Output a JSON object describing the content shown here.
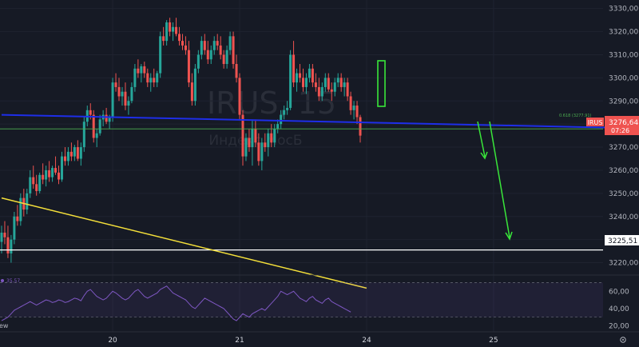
{
  "watermark": {
    "symbol": "IRUS, 15",
    "name": "Индекс МосБ"
  },
  "symbol_badge": "IRUS",
  "last_price_label": "3276,64",
  "countdown_label": "07:26",
  "support_label": "3225,51",
  "fib_label": "0.618 (3277.91)",
  "rsi_label": "35,57",
  "side_label": "ew",
  "footer_icon": "settings-icon",
  "colors": {
    "background": "#161a25",
    "up": "#26a69a",
    "down": "#ef5350",
    "blue_line": "#1e2ee8",
    "yellow_line": "#f5e03a",
    "arrow": "#39e63a",
    "rsi": "#7e57c2",
    "support": "#ffffff",
    "fib": "#4caf50"
  },
  "chart_data": {
    "type": "candlestick",
    "price_axis": {
      "ylim": [
        3215.0,
        3333.0
      ],
      "ticks": [
        "3330,00",
        "3320,00",
        "3310,00",
        "3300,00",
        "3290,00",
        "3280,00",
        "3270,00",
        "3260,00",
        "3250,00",
        "3240,00",
        "3230,00",
        "3220,00"
      ]
    },
    "x_ticks": [
      "20",
      "21",
      "24",
      "25"
    ],
    "x_tick_bars": [
      35,
      75,
      115,
      155
    ],
    "bars_visible": 190,
    "candles": [
      [
        3229,
        3236,
        3224,
        3233
      ],
      [
        3233,
        3238,
        3228,
        3231
      ],
      [
        3231,
        3236,
        3222,
        3224
      ],
      [
        3224,
        3232,
        3220,
        3230
      ],
      [
        3230,
        3242,
        3228,
        3240
      ],
      [
        3240,
        3245,
        3236,
        3238
      ],
      [
        3238,
        3250,
        3236,
        3248
      ],
      [
        3248,
        3252,
        3240,
        3243
      ],
      [
        3243,
        3252,
        3241,
        3250
      ],
      [
        3250,
        3260,
        3248,
        3257
      ],
      [
        3257,
        3262,
        3252,
        3254
      ],
      [
        3254,
        3258,
        3249,
        3251
      ],
      [
        3251,
        3259,
        3250,
        3258
      ],
      [
        3258,
        3263,
        3254,
        3256
      ],
      [
        3256,
        3262,
        3253,
        3260
      ],
      [
        3260,
        3264,
        3255,
        3257
      ],
      [
        3257,
        3262,
        3255,
        3261
      ],
      [
        3261,
        3266,
        3258,
        3259
      ],
      [
        3259,
        3262,
        3254,
        3256
      ],
      [
        3256,
        3268,
        3255,
        3266
      ],
      [
        3266,
        3270,
        3262,
        3264
      ],
      [
        3264,
        3270,
        3262,
        3268
      ],
      [
        3268,
        3272,
        3264,
        3266
      ],
      [
        3266,
        3271,
        3264,
        3270
      ],
      [
        3270,
        3273,
        3264,
        3265
      ],
      [
        3265,
        3272,
        3262,
        3270
      ],
      [
        3270,
        3283,
        3268,
        3281
      ],
      [
        3281,
        3288,
        3279,
        3286
      ],
      [
        3286,
        3289,
        3282,
        3284
      ],
      [
        3284,
        3286,
        3272,
        3274
      ],
      [
        3274,
        3278,
        3270,
        3276
      ],
      [
        3276,
        3284,
        3275,
        3282
      ],
      [
        3282,
        3286,
        3279,
        3284
      ],
      [
        3284,
        3287,
        3280,
        3281
      ],
      [
        3281,
        3284,
        3278,
        3283
      ],
      [
        3283,
        3300,
        3281,
        3298
      ],
      [
        3298,
        3302,
        3294,
        3296
      ],
      [
        3296,
        3300,
        3290,
        3292
      ],
      [
        3292,
        3296,
        3288,
        3294
      ],
      [
        3294,
        3298,
        3286,
        3288
      ],
      [
        3288,
        3292,
        3284,
        3290
      ],
      [
        3290,
        3298,
        3289,
        3296
      ],
      [
        3296,
        3306,
        3294,
        3304
      ],
      [
        3304,
        3308,
        3300,
        3302
      ],
      [
        3302,
        3306,
        3298,
        3305
      ],
      [
        3305,
        3307,
        3300,
        3302
      ],
      [
        3302,
        3304,
        3296,
        3298
      ],
      [
        3298,
        3302,
        3294,
        3300
      ],
      [
        3300,
        3304,
        3296,
        3298
      ],
      [
        3298,
        3303,
        3296,
        3302
      ],
      [
        3302,
        3320,
        3300,
        3318
      ],
      [
        3318,
        3322,
        3314,
        3316
      ],
      [
        3316,
        3325,
        3314,
        3324
      ],
      [
        3324,
        3326,
        3318,
        3320
      ],
      [
        3320,
        3324,
        3316,
        3322
      ],
      [
        3322,
        3326,
        3318,
        3319
      ],
      [
        3319,
        3322,
        3314,
        3316
      ],
      [
        3316,
        3319,
        3312,
        3314
      ],
      [
        3314,
        3318,
        3310,
        3312
      ],
      [
        3312,
        3316,
        3296,
        3298
      ],
      [
        3298,
        3302,
        3288,
        3290
      ],
      [
        3290,
        3306,
        3288,
        3304
      ],
      [
        3304,
        3312,
        3302,
        3310
      ],
      [
        3310,
        3318,
        3308,
        3316
      ],
      [
        3316,
        3319,
        3310,
        3312
      ],
      [
        3312,
        3316,
        3306,
        3308
      ],
      [
        3308,
        3314,
        3306,
        3312
      ],
      [
        3312,
        3318,
        3310,
        3316
      ],
      [
        3316,
        3319,
        3312,
        3314
      ],
      [
        3314,
        3318,
        3308,
        3310
      ],
      [
        3310,
        3312,
        3304,
        3306
      ],
      [
        3306,
        3314,
        3304,
        3312
      ],
      [
        3312,
        3320,
        3310,
        3318
      ],
      [
        3318,
        3320,
        3304,
        3306
      ],
      [
        3306,
        3310,
        3298,
        3300
      ],
      [
        3300,
        3302,
        3282,
        3284
      ],
      [
        3284,
        3286,
        3262,
        3266
      ],
      [
        3266,
        3276,
        3264,
        3274
      ],
      [
        3274,
        3278,
        3268,
        3270
      ],
      [
        3270,
        3282,
        3262,
        3278
      ],
      [
        3278,
        3282,
        3270,
        3272
      ],
      [
        3272,
        3276,
        3262,
        3264
      ],
      [
        3264,
        3274,
        3260,
        3272
      ],
      [
        3272,
        3276,
        3268,
        3270
      ],
      [
        3270,
        3278,
        3266,
        3276
      ],
      [
        3276,
        3280,
        3270,
        3272
      ],
      [
        3272,
        3280,
        3270,
        3278
      ],
      [
        3278,
        3282,
        3276,
        3280
      ],
      [
        3280,
        3286,
        3278,
        3284
      ],
      [
        3284,
        3288,
        3282,
        3286
      ],
      [
        3286,
        3290,
        3284,
        3287
      ],
      [
        3287,
        3312,
        3286,
        3310
      ],
      [
        3310,
        3316,
        3296,
        3298
      ],
      [
        3298,
        3304,
        3294,
        3302
      ],
      [
        3302,
        3306,
        3298,
        3300
      ],
      [
        3300,
        3304,
        3294,
        3296
      ],
      [
        3296,
        3302,
        3293,
        3300
      ],
      [
        3300,
        3306,
        3298,
        3304
      ],
      [
        3304,
        3306,
        3296,
        3298
      ],
      [
        3298,
        3302,
        3294,
        3296
      ],
      [
        3296,
        3300,
        3290,
        3292
      ],
      [
        3292,
        3298,
        3290,
        3296
      ],
      [
        3296,
        3302,
        3294,
        3300
      ],
      [
        3300,
        3302,
        3294,
        3295
      ],
      [
        3295,
        3298,
        3290,
        3294
      ],
      [
        3294,
        3300,
        3292,
        3298
      ],
      [
        3298,
        3302,
        3296,
        3300
      ],
      [
        3300,
        3302,
        3294,
        3296
      ],
      [
        3296,
        3300,
        3292,
        3298
      ],
      [
        3298,
        3300,
        3290,
        3292
      ],
      [
        3292,
        3294,
        3284,
        3286
      ],
      [
        3286,
        3290,
        3282,
        3288
      ],
      [
        3288,
        3290,
        3280,
        3283
      ],
      [
        3283,
        3284,
        3272,
        3275
      ]
    ],
    "overlays": [
      {
        "name": "0.618 (3277.91)",
        "type": "horizontal",
        "value": 3277.91
      },
      {
        "name": "support",
        "type": "horizontal",
        "value": 3225.51
      },
      {
        "name": "resistance-trendline",
        "type": "line",
        "from": [
          0,
          3284.0
        ],
        "to": [
          190,
          3278.5
        ]
      },
      {
        "name": "yellow-trendline",
        "type": "line",
        "from": [
          0,
          3248.0
        ],
        "to": [
          115,
          3209.0
        ]
      }
    ],
    "rsi": {
      "ylim": [
        15,
        75
      ],
      "ticks": [
        "60,00",
        "40,00",
        "20,00"
      ],
      "bands": [
        70,
        30
      ],
      "values": [
        26,
        28,
        30,
        34,
        38,
        40,
        42,
        44,
        46,
        48,
        46,
        44,
        46,
        48,
        50,
        49,
        47,
        48,
        50,
        49,
        47,
        48,
        50,
        52,
        51,
        49,
        55,
        60,
        62,
        58,
        54,
        52,
        50,
        52,
        56,
        60,
        58,
        55,
        52,
        50,
        52,
        56,
        60,
        62,
        58,
        54,
        52,
        54,
        56,
        58,
        62,
        64,
        66,
        62,
        58,
        56,
        54,
        52,
        50,
        46,
        42,
        40,
        44,
        48,
        52,
        50,
        48,
        46,
        44,
        42,
        40,
        36,
        32,
        28,
        26,
        30,
        34,
        32,
        30,
        34,
        36,
        38,
        40,
        38,
        42,
        46,
        50,
        54,
        60,
        58,
        56,
        58,
        60,
        56,
        52,
        50,
        48,
        52,
        54,
        50,
        48,
        46,
        50,
        52,
        48,
        46,
        44,
        42,
        40,
        38,
        36
      ]
    }
  }
}
